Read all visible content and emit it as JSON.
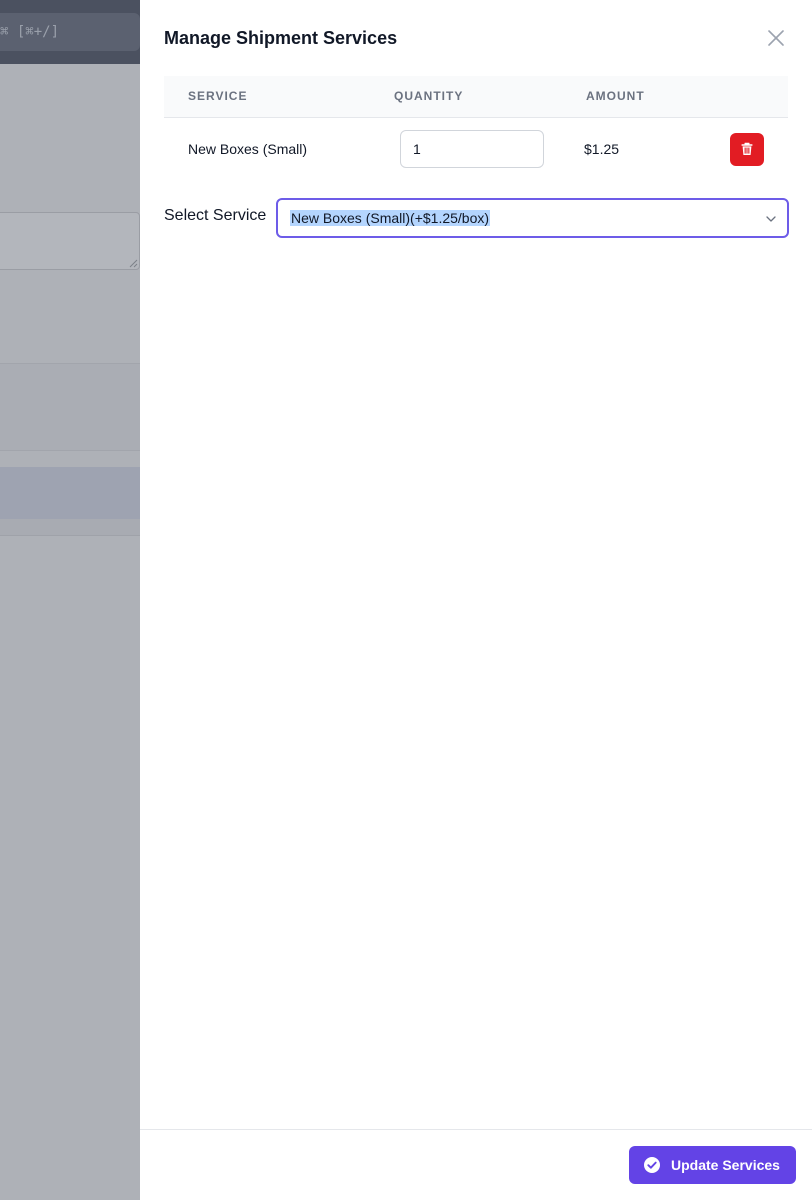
{
  "background": {
    "search_hint": "⌘ [⌘+/]"
  },
  "drawer": {
    "title": "Manage Shipment Services",
    "table": {
      "headers": [
        "SERVICE",
        "QUANTITY",
        "AMOUNT"
      ],
      "rows": [
        {
          "service": "New Boxes (Small)",
          "quantity": "1",
          "amount": "$1.25"
        }
      ]
    },
    "select": {
      "label": "Select Service",
      "value": "New Boxes (Small)(+$1.25/box)"
    },
    "footer": {
      "update_label": "Update Services"
    }
  },
  "colors": {
    "accent": "#6343e6",
    "focus_ring": "#6d5ce8",
    "danger": "#e21c23",
    "selection": "#b4d5fe"
  }
}
